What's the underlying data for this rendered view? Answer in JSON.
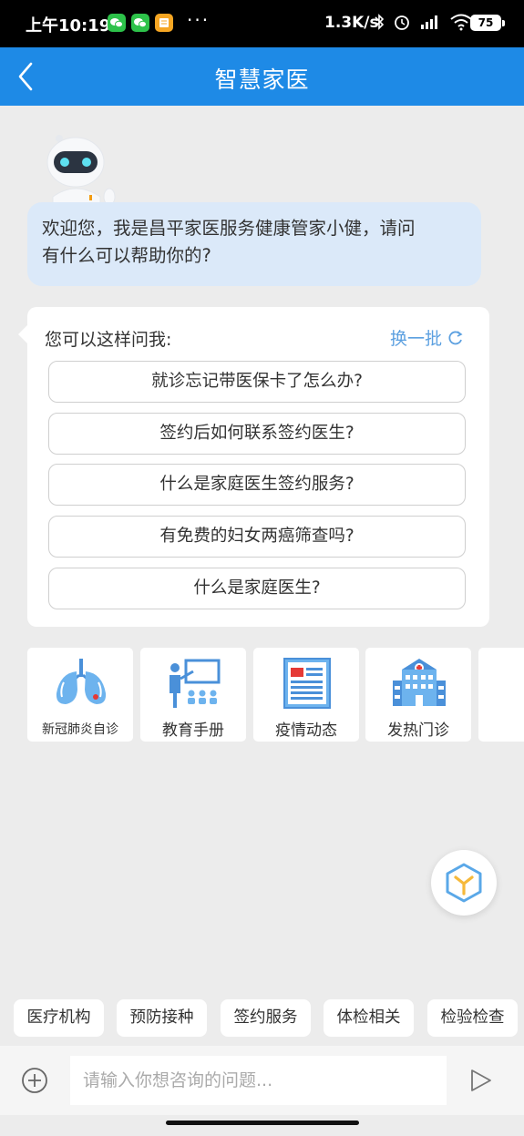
{
  "status_bar": {
    "time": "上午10:19",
    "more": "···",
    "net_speed": "1.3K/s",
    "battery": "75",
    "app_icons": [
      "wechat-icon",
      "wechat-icon",
      "notes-icon"
    ],
    "system_icons": [
      "bluetooth-icon",
      "alarm-icon",
      "signal-icon",
      "wifi-icon"
    ]
  },
  "header": {
    "title": "智慧家医",
    "back_icon": "chevron-left-icon",
    "color": "#1e8ae6"
  },
  "chat": {
    "welcome_line1": "欢迎您，我是昌平家医服务健康管家小健，请问",
    "welcome_line2": "有什么可以帮助你的?"
  },
  "suggestions": {
    "title": "您可以这样问我:",
    "refresh_label": "换一批",
    "questions": [
      "就诊忘记带医保卡了怎么办?",
      "签约后如何联系签约医生?",
      "什么是家庭医生签约服务?",
      "有免费的妇女两癌筛查吗?",
      "什么是家庭医生?"
    ]
  },
  "tiles": [
    {
      "label": "新冠肺炎自诊",
      "icon": "lungs-icon"
    },
    {
      "label": "教育手册",
      "icon": "teacher-icon"
    },
    {
      "label": "疫情动态",
      "icon": "newspaper-icon"
    },
    {
      "label": "发热门诊",
      "icon": "hospital-icon"
    }
  ],
  "chips": [
    "医疗机构",
    "预防接种",
    "签约服务",
    "体检相关",
    "检验检查"
  ],
  "input": {
    "placeholder": "请输入你想咨询的问题..."
  },
  "accent_color": "#1e8ae6"
}
